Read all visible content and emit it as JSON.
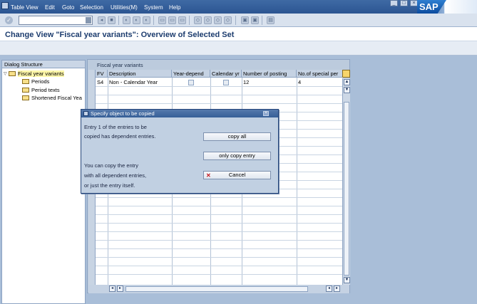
{
  "menubar": {
    "items": [
      "Table View",
      "Edit",
      "Goto",
      "Selection",
      "Utilities(M)",
      "System",
      "Help"
    ],
    "logo": "SAP",
    "icons": [
      "window-system-icon",
      "minimize-icon",
      "restore-icon",
      "close-icon"
    ]
  },
  "toolbar": {
    "command_value": "",
    "icons": [
      "enter-icon",
      "save-icon",
      "back-icon",
      "exit-icon",
      "cancel-icon",
      "print-icon",
      "find-icon",
      "find-next-icon",
      "first-page-icon",
      "previous-page-icon",
      "next-page-icon",
      "last-page-icon",
      "new-session-icon",
      "shortcut-icon",
      "help-icon",
      "layout-icon"
    ]
  },
  "title": "Change View \"Fiscal year variants\": Overview of Selected Set",
  "dialog_structure": {
    "header": "Dialog Structure",
    "nodes": [
      {
        "label": "Fiscal year variants",
        "selected": true,
        "expanded": true
      },
      {
        "label": "Periods"
      },
      {
        "label": "Period texts"
      },
      {
        "label": "Shortened Fiscal Yea"
      }
    ]
  },
  "table": {
    "caption": "Fiscal year variants",
    "columns": [
      "FV",
      "Description",
      "Year-depend",
      "Calendar yr",
      "Number of posting",
      "No.of special per"
    ],
    "rows": [
      {
        "fv": "S4",
        "description": "Non - Calendar Year",
        "year_dependent": false,
        "calendar_year": false,
        "posting_periods": "12",
        "special_periods": "4"
      }
    ]
  },
  "popup": {
    "title": "Specify object to be copied",
    "lines": [
      "Entry  1  of the entries to be",
      "copied has dependent entries.",
      "You can copy the entry",
      "with all dependent entries,",
      "or just the entry itself."
    ],
    "buttons": {
      "copy_all": "copy all",
      "only_copy_entry": "only copy entry",
      "cancel": "Cancel"
    }
  }
}
